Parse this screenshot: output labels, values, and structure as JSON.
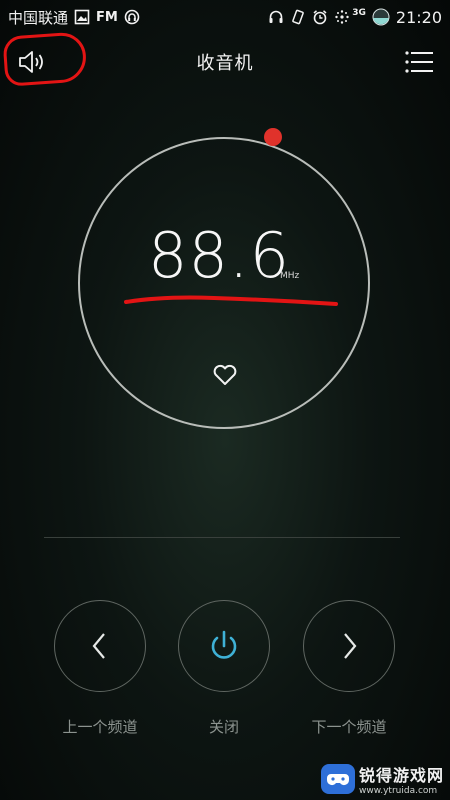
{
  "status_bar": {
    "carrier": "中国联通",
    "fm_label": "FM",
    "network": "3G",
    "time": "21:20",
    "icons": [
      "image-icon",
      "headset-icon",
      "headphones-icon",
      "vibrate-icon",
      "alarm-icon",
      "signal-icon",
      "battery-icon"
    ]
  },
  "header": {
    "title": "收音机",
    "left_icon": "speaker-icon",
    "right_icon": "menu-icon"
  },
  "tuner": {
    "frequency": "88.6",
    "unit": "MHz",
    "favorite_icon": "heart-icon"
  },
  "controls": {
    "prev_label": "上一个频道",
    "power_label": "关闭",
    "next_label": "下一个频道"
  },
  "watermark": {
    "name": "锐得游戏网",
    "url": "www.ytruida.com"
  },
  "colors": {
    "accent_knob": "#e0322b",
    "power_icon": "#3fb1d6",
    "annotation": "#e31414"
  }
}
